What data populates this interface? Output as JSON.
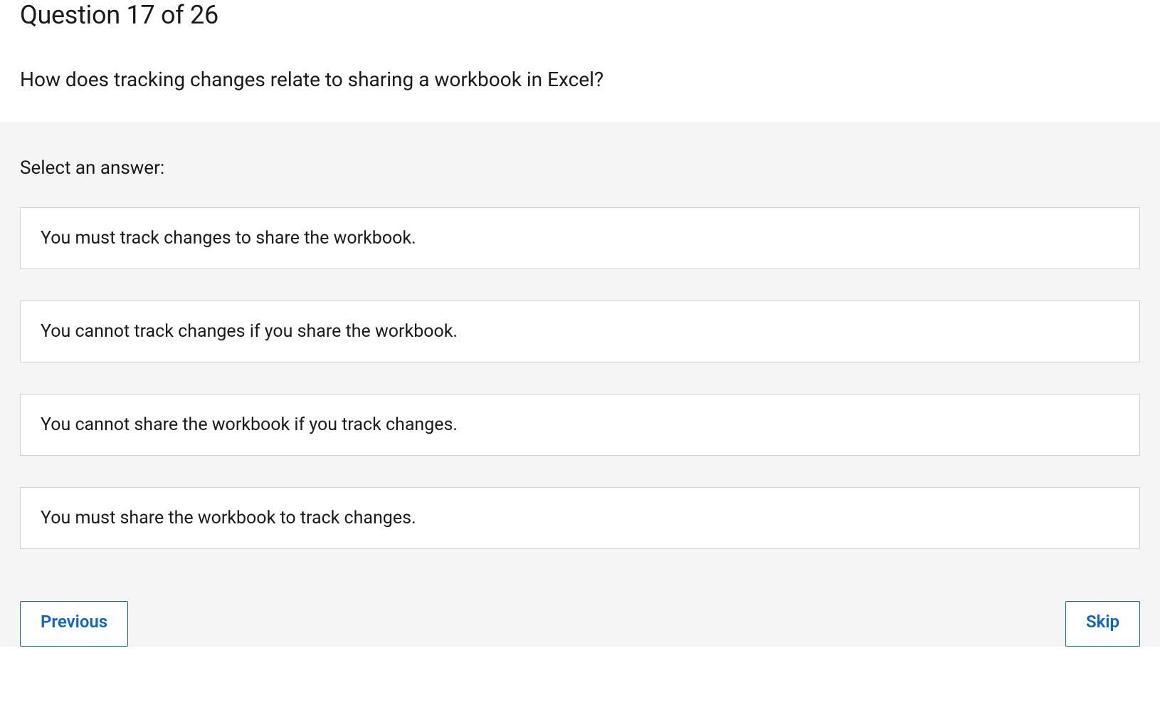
{
  "header": {
    "question_number": "Question 17 of 26",
    "question_text": "How does tracking changes relate to sharing a workbook in Excel?"
  },
  "answer_section": {
    "select_label": "Select an answer:",
    "options": [
      "You must track changes to share the workbook.",
      "You cannot track changes if you share the workbook.",
      "You cannot share the workbook if you track changes.",
      "You must share the workbook to track changes."
    ]
  },
  "nav": {
    "previous_label": "Previous",
    "skip_label": "Skip"
  }
}
